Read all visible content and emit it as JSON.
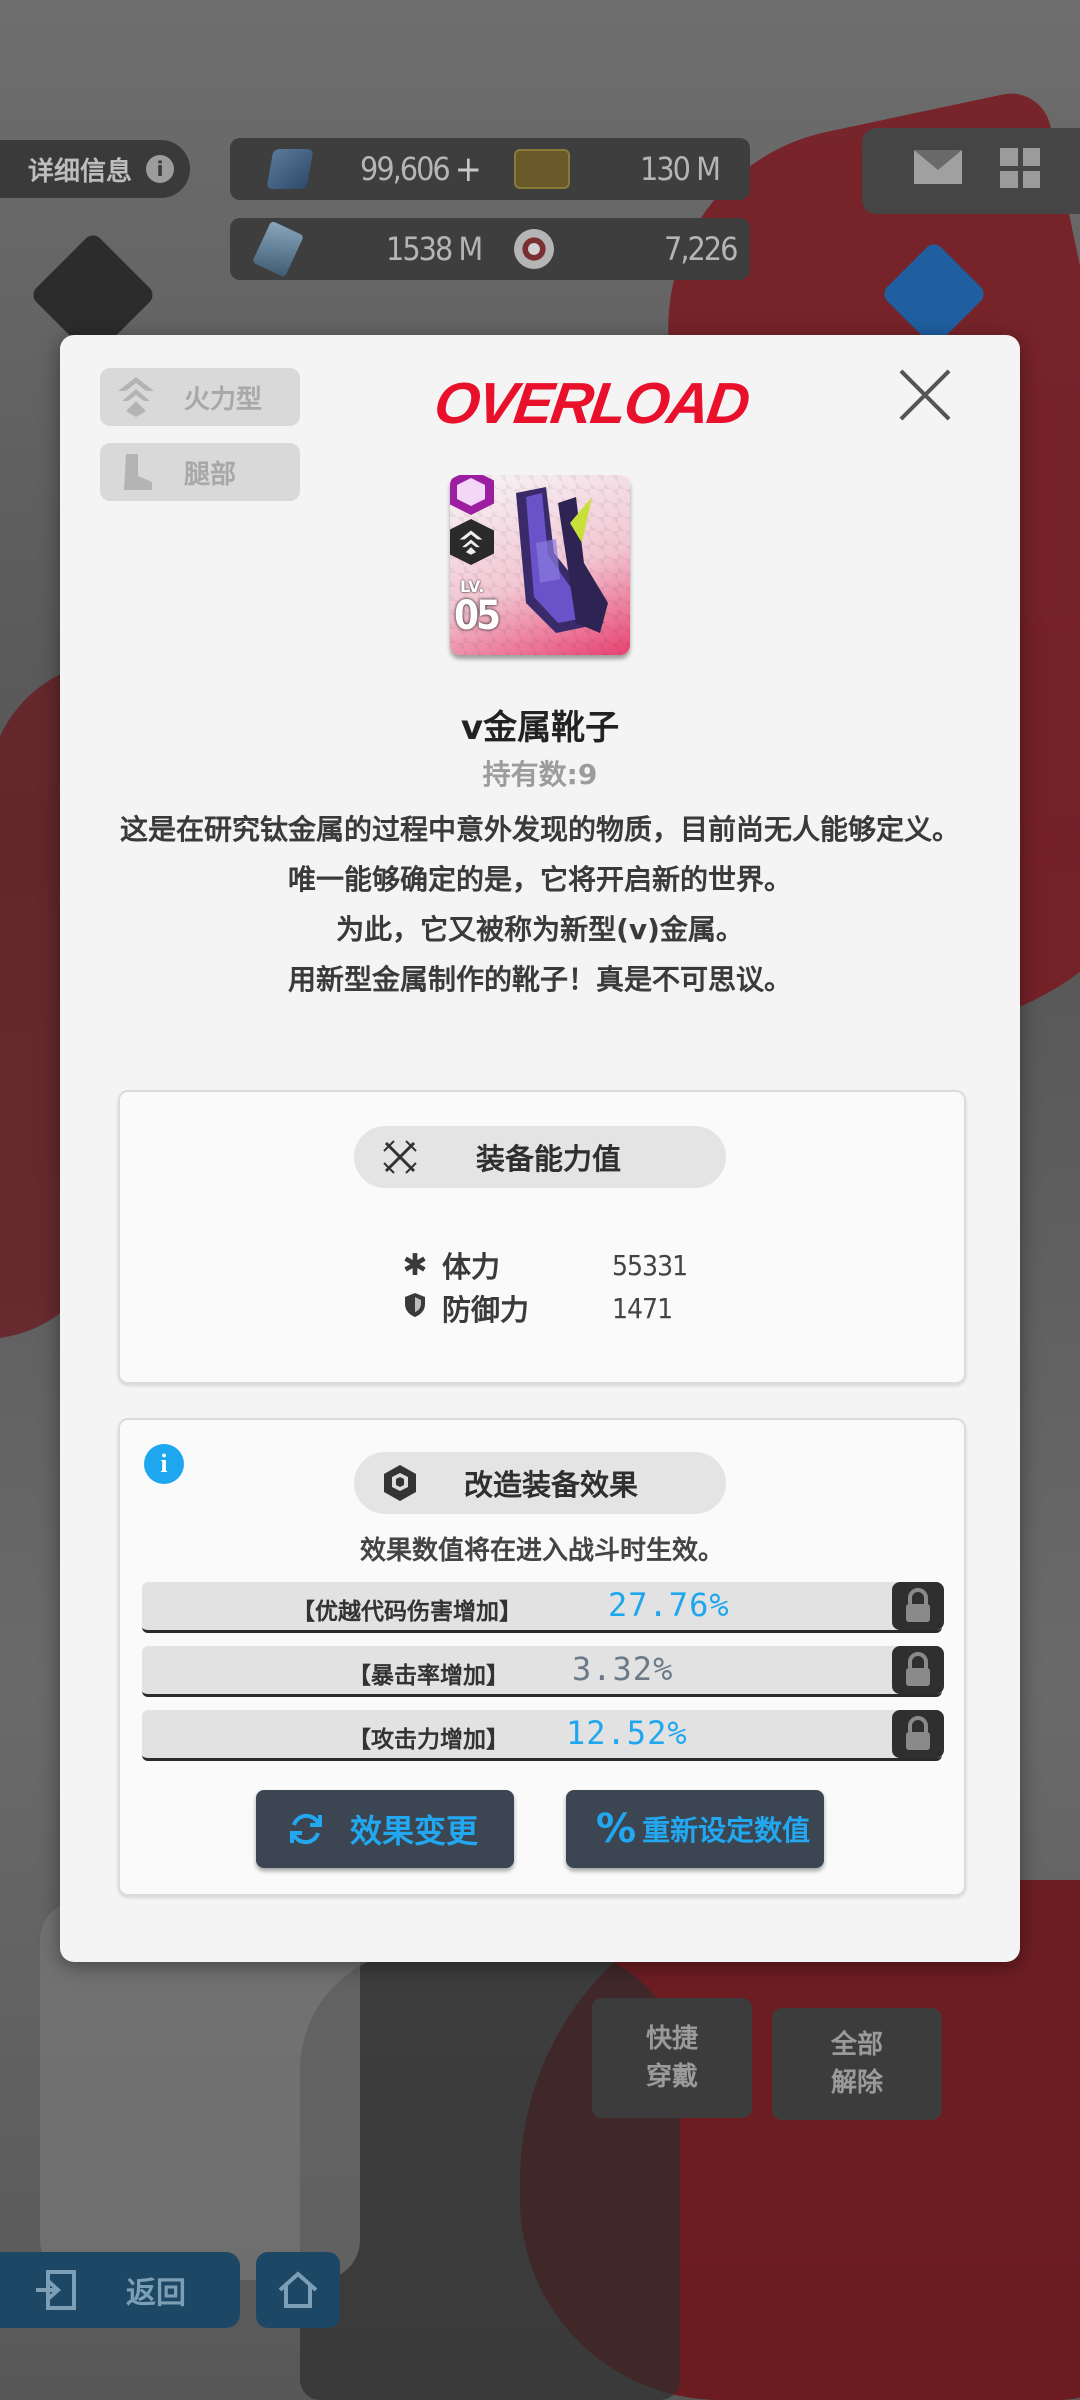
{
  "hud": {
    "info_label": "详细信息",
    "info_icon": "i",
    "gems": "99,606",
    "plus": "+",
    "credits": "130 M",
    "core_dust": "1538 M",
    "battle_data": "7,226"
  },
  "modal": {
    "class_tag": "火力型",
    "slot_tag": "腿部",
    "brand": "OVERLOAD",
    "item": {
      "lv_label": "LV.",
      "level": "05",
      "name": "v金属靴子",
      "count": "持有数:9"
    },
    "description": [
      "这是在研究钛金属的过程中意外发现的物质，目前尚无人能够定义。",
      "唯一能够确定的是，它将开启新的世界。",
      "为此，它又被称为新型(v)金属。",
      "用新型金属制作的靴子！真是不可思议。"
    ],
    "stats_panel": {
      "title": "装备能力值",
      "stats": [
        {
          "icon": "✱",
          "label": "体力",
          "value": "55331"
        },
        {
          "icon": "shield",
          "label": "防御力",
          "value": "1471"
        }
      ]
    },
    "effects_panel": {
      "info_icon": "i",
      "title": "改造装备效果",
      "note": "效果数值将在进入战斗时生效。",
      "effects": [
        {
          "label": "【优越代码伤害增加】",
          "value": "27.76%",
          "color": "#1ea6ef"
        },
        {
          "label": "【暴击率增加】",
          "value": "3.32%",
          "color": "#6b7a86"
        },
        {
          "label": "【攻击力增加】",
          "value": "12.52%",
          "color": "#1ea6ef"
        }
      ],
      "change_button": "效果变更",
      "reset_button": "重新设定数值",
      "reset_icon": "%"
    }
  },
  "bottom": {
    "quick_equip": [
      "快捷",
      "穿戴"
    ],
    "unequip_all": [
      "全部",
      "解除"
    ],
    "back_label": "返回"
  },
  "colors": {
    "accent_blue": "#1ea6ef",
    "brand_red": "#e8102a",
    "rarity_purple": "#9b1fa0"
  }
}
